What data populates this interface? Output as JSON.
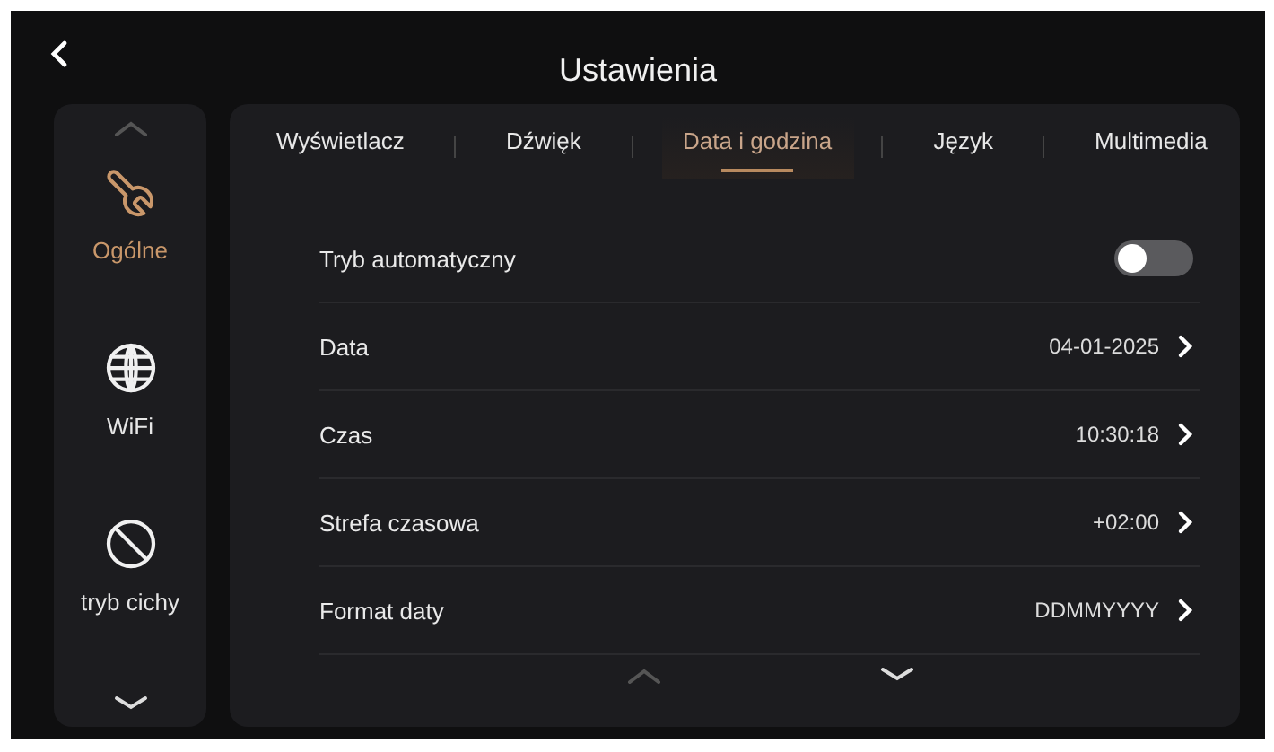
{
  "header": {
    "title": "Ustawienia"
  },
  "sidebar": {
    "items": [
      {
        "label": "Ogólne",
        "selected": true
      },
      {
        "label": "WiFi",
        "selected": false
      },
      {
        "label": "tryb cichy",
        "selected": false
      }
    ]
  },
  "tabs": [
    {
      "label": "Wyświetlacz",
      "selected": false
    },
    {
      "label": "Dźwięk",
      "selected": false
    },
    {
      "label": "Data i godzina",
      "selected": true
    },
    {
      "label": "Język",
      "selected": false
    },
    {
      "label": "Multimedia",
      "selected": false
    }
  ],
  "settings": [
    {
      "kind": "toggle",
      "label": "Tryb automatyczny",
      "on": false
    },
    {
      "kind": "link",
      "label": "Data",
      "value": "04-01-2025"
    },
    {
      "kind": "link",
      "label": "Czas",
      "value": "10:30:18"
    },
    {
      "kind": "link",
      "label": "Strefa czasowa",
      "value": "+02:00"
    },
    {
      "kind": "link",
      "label": "Format daty",
      "value": "DDMMYYYY"
    }
  ]
}
